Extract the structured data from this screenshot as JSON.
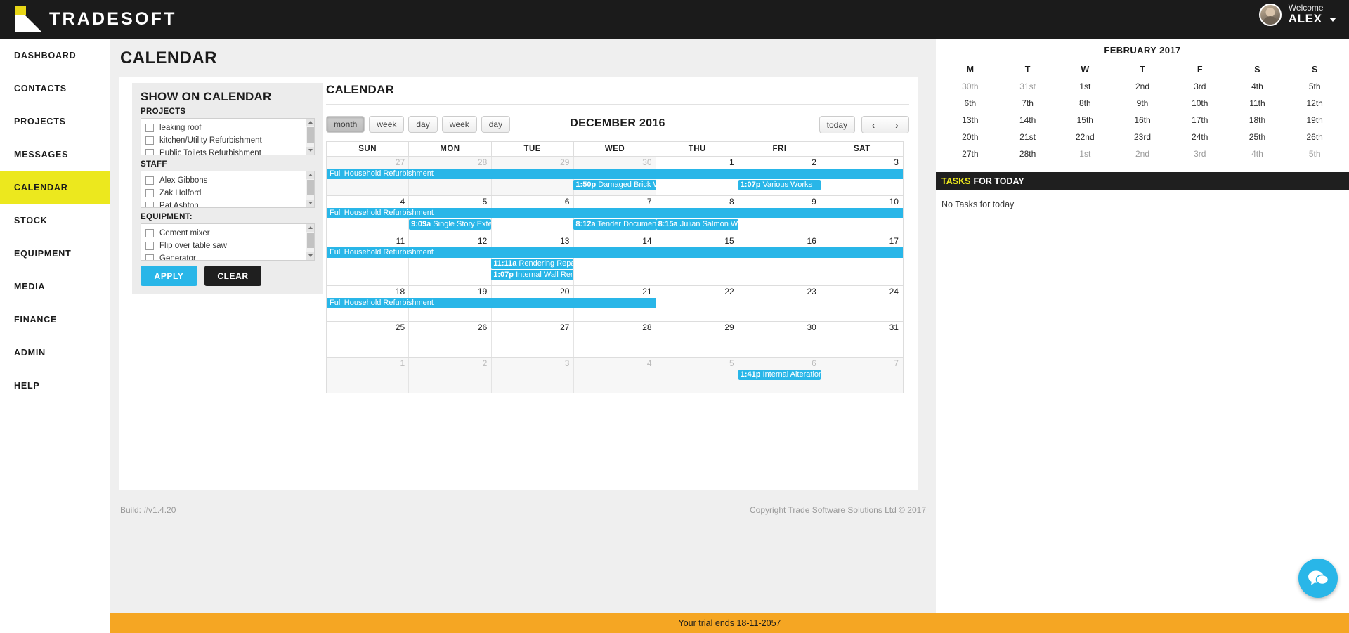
{
  "header": {
    "brand": "TRADESOFT",
    "welcome_label": "Welcome",
    "user_name": "ALEX"
  },
  "sidebar": {
    "items": [
      {
        "label": "DASHBOARD",
        "active": false
      },
      {
        "label": "CONTACTS",
        "active": false
      },
      {
        "label": "PROJECTS",
        "active": false
      },
      {
        "label": "MESSAGES",
        "active": false
      },
      {
        "label": "CALENDAR",
        "active": true
      },
      {
        "label": "STOCK",
        "active": false
      },
      {
        "label": "EQUIPMENT",
        "active": false
      },
      {
        "label": "MEDIA",
        "active": false
      },
      {
        "label": "FINANCE",
        "active": false
      },
      {
        "label": "ADMIN",
        "active": false
      },
      {
        "label": "HELP",
        "active": false
      }
    ]
  },
  "page": {
    "title": "CALENDAR"
  },
  "filters": {
    "title": "SHOW ON CALENDAR",
    "projects_label": "PROJECTS",
    "projects": [
      "leaking roof",
      "kitchen/Utility Refurbishment",
      "Public Toilets Refurbishment"
    ],
    "staff_label": "STAFF",
    "staff": [
      "Alex Gibbons",
      "Zak Holford",
      "Pat Ashton"
    ],
    "equipment_label": "EQUIPMENT:",
    "equipment": [
      "Cement mixer",
      "Flip over table saw",
      "Generator"
    ],
    "apply_label": "APPLY",
    "clear_label": "CLEAR"
  },
  "calendar": {
    "heading": "CALENDAR",
    "month_title": "DECEMBER 2016",
    "view_buttons": [
      {
        "label": "month",
        "active": true
      },
      {
        "label": "week",
        "active": false
      },
      {
        "label": "day",
        "active": false
      },
      {
        "label": "week",
        "active": false
      },
      {
        "label": "day",
        "active": false
      }
    ],
    "today_label": "today",
    "prev_label": "‹",
    "next_label": "›",
    "day_headers": [
      "SUN",
      "MON",
      "TUE",
      "WED",
      "THU",
      "FRI",
      "SAT"
    ],
    "weeks": [
      {
        "days": [
          {
            "num": "27",
            "other": true
          },
          {
            "num": "28",
            "other": true
          },
          {
            "num": "29",
            "other": true
          },
          {
            "num": "30",
            "other": true
          },
          {
            "num": "1",
            "other": false
          },
          {
            "num": "2",
            "other": false
          },
          {
            "num": "3",
            "other": false
          }
        ],
        "lines": [
          [
            {
              "title": "Full Household Refurbishment",
              "time": "",
              "start": 0,
              "span": 7,
              "block": true
            }
          ],
          [
            {
              "title": "Damaged Brick W…",
              "time": "1:50p",
              "start": 3,
              "span": 1,
              "block": false
            },
            {
              "title": "Various Works",
              "time": "1:07p",
              "start": 5,
              "span": 1,
              "block": false
            }
          ]
        ]
      },
      {
        "days": [
          {
            "num": "4",
            "other": false
          },
          {
            "num": "5",
            "other": false
          },
          {
            "num": "6",
            "other": false
          },
          {
            "num": "7",
            "other": false
          },
          {
            "num": "8",
            "other": false
          },
          {
            "num": "9",
            "other": false
          },
          {
            "num": "10",
            "other": false
          }
        ],
        "lines": [
          [
            {
              "title": "Full Household Refurbishment",
              "time": "",
              "start": 0,
              "span": 7,
              "block": true
            }
          ],
          [
            {
              "title": "Single Story Exten",
              "time": "9:09a",
              "start": 1,
              "span": 1,
              "block": false
            },
            {
              "title": "Tender Documents",
              "time": "8:12a",
              "start": 3,
              "span": 1,
              "block": false
            },
            {
              "title": "Julian Salmon WC",
              "time": "8:15a",
              "start": 4,
              "span": 1,
              "block": false
            }
          ]
        ]
      },
      {
        "days": [
          {
            "num": "11",
            "other": false
          },
          {
            "num": "12",
            "other": false
          },
          {
            "num": "13",
            "other": false
          },
          {
            "num": "14",
            "other": false
          },
          {
            "num": "15",
            "other": false
          },
          {
            "num": "16",
            "other": false
          },
          {
            "num": "17",
            "other": false
          }
        ],
        "lines": [
          [
            {
              "title": "Full Household Refurbishment",
              "time": "",
              "start": 0,
              "span": 7,
              "block": true
            }
          ],
          [
            {
              "title": "Rendering Repai",
              "time": "11:11a",
              "start": 2,
              "span": 1,
              "block": false
            }
          ],
          [
            {
              "title": "Internal Wall Rem",
              "time": "1:07p",
              "start": 2,
              "span": 1,
              "block": false
            }
          ]
        ]
      },
      {
        "days": [
          {
            "num": "18",
            "other": false
          },
          {
            "num": "19",
            "other": false
          },
          {
            "num": "20",
            "other": false
          },
          {
            "num": "21",
            "other": false
          },
          {
            "num": "22",
            "other": false
          },
          {
            "num": "23",
            "other": false
          },
          {
            "num": "24",
            "other": false
          }
        ],
        "lines": [
          [
            {
              "title": "Full Household Refurbishment",
              "time": "",
              "start": 0,
              "span": 4,
              "block": true
            }
          ]
        ]
      },
      {
        "days": [
          {
            "num": "25",
            "other": false
          },
          {
            "num": "26",
            "other": false
          },
          {
            "num": "27",
            "other": false
          },
          {
            "num": "28",
            "other": false
          },
          {
            "num": "29",
            "other": false
          },
          {
            "num": "30",
            "other": false
          },
          {
            "num": "31",
            "other": false
          }
        ],
        "lines": []
      },
      {
        "days": [
          {
            "num": "1",
            "other": true
          },
          {
            "num": "2",
            "other": true
          },
          {
            "num": "3",
            "other": true
          },
          {
            "num": "4",
            "other": true
          },
          {
            "num": "5",
            "other": true
          },
          {
            "num": "6",
            "other": true
          },
          {
            "num": "7",
            "other": true
          }
        ],
        "lines": [
          [
            {
              "title": "Internal Alterations",
              "time": "1:41p",
              "start": 5,
              "span": 1,
              "block": false
            }
          ]
        ]
      }
    ]
  },
  "mini_calendar": {
    "title": "FEBRUARY 2017",
    "day_headers": [
      "M",
      "T",
      "W",
      "T",
      "F",
      "S",
      "S"
    ],
    "rows": [
      [
        {
          "label": "30th",
          "dim": true
        },
        {
          "label": "31st",
          "dim": true
        },
        {
          "label": "1st",
          "dim": false
        },
        {
          "label": "2nd",
          "dim": false
        },
        {
          "label": "3rd",
          "dim": false
        },
        {
          "label": "4th",
          "dim": false
        },
        {
          "label": "5th",
          "dim": false
        }
      ],
      [
        {
          "label": "6th",
          "dim": false
        },
        {
          "label": "7th",
          "dim": false
        },
        {
          "label": "8th",
          "dim": false
        },
        {
          "label": "9th",
          "dim": false
        },
        {
          "label": "10th",
          "dim": false
        },
        {
          "label": "11th",
          "dim": false
        },
        {
          "label": "12th",
          "dim": false
        }
      ],
      [
        {
          "label": "13th",
          "dim": false
        },
        {
          "label": "14th",
          "dim": false
        },
        {
          "label": "15th",
          "dim": false
        },
        {
          "label": "16th",
          "dim": false
        },
        {
          "label": "17th",
          "dim": false
        },
        {
          "label": "18th",
          "dim": false
        },
        {
          "label": "19th",
          "dim": false
        }
      ],
      [
        {
          "label": "20th",
          "dim": false
        },
        {
          "label": "21st",
          "dim": false
        },
        {
          "label": "22nd",
          "dim": false
        },
        {
          "label": "23rd",
          "dim": false
        },
        {
          "label": "24th",
          "dim": false
        },
        {
          "label": "25th",
          "dim": false
        },
        {
          "label": "26th",
          "dim": false
        }
      ],
      [
        {
          "label": "27th",
          "dim": false
        },
        {
          "label": "28th",
          "dim": false
        },
        {
          "label": "1st",
          "dim": true
        },
        {
          "label": "2nd",
          "dim": true
        },
        {
          "label": "3rd",
          "dim": true
        },
        {
          "label": "4th",
          "dim": true
        },
        {
          "label": "5th",
          "dim": true
        }
      ]
    ]
  },
  "tasks": {
    "bar_highlight": "TASKS",
    "bar_rest": "FOR TODAY",
    "empty_text": "No Tasks for today"
  },
  "footer": {
    "build": "Build: #v1.4.20",
    "copyright": "Copyright Trade Software Solutions Ltd © 2017"
  },
  "trial_banner": {
    "text": "Your trial ends 18-11-2057"
  },
  "colors": {
    "brand_yellow": "#ece81e",
    "accent_blue": "#29b6e8",
    "dark": "#1b1b1b",
    "trial_orange": "#f5a623"
  }
}
